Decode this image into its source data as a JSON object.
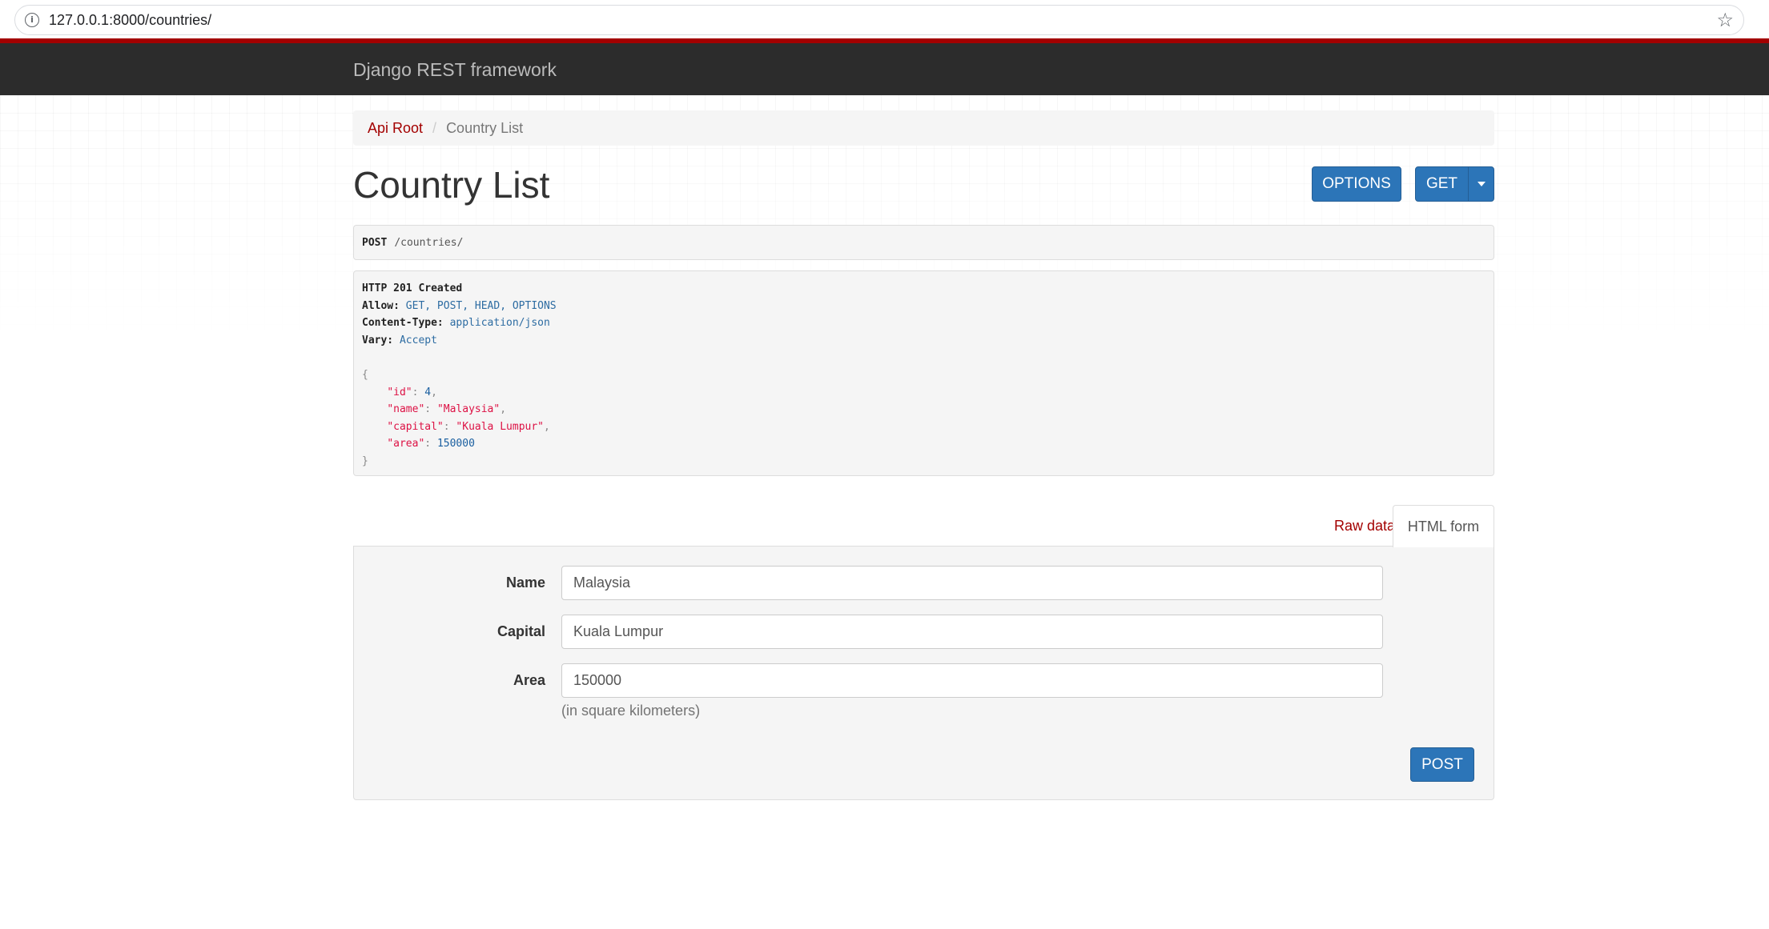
{
  "browser": {
    "url": "127.0.0.1:8000/countries/"
  },
  "navbar": {
    "brand": "Django REST framework"
  },
  "breadcrumb": {
    "items": [
      {
        "label": "Api Root"
      },
      {
        "label": "Country List"
      }
    ],
    "separator": "/"
  },
  "page": {
    "title": "Country List"
  },
  "buttons": {
    "options": "OPTIONS",
    "get": "GET",
    "post": "POST"
  },
  "request": {
    "method": "POST",
    "path": "/countries/"
  },
  "response": {
    "status": "HTTP 201 Created",
    "headers": [
      {
        "name": "Allow:",
        "value": "GET, POST, HEAD, OPTIONS"
      },
      {
        "name": "Content-Type:",
        "value": "application/json"
      },
      {
        "name": "Vary:",
        "value": "Accept"
      }
    ],
    "body": {
      "open": "{",
      "close": "}",
      "fields": [
        {
          "key": "\"id\"",
          "value": "4",
          "value_type": "number",
          "comma": ","
        },
        {
          "key": "\"name\"",
          "value": "\"Malaysia\"",
          "value_type": "string",
          "comma": ","
        },
        {
          "key": "\"capital\"",
          "value": "\"Kuala Lumpur\"",
          "value_type": "string",
          "comma": ","
        },
        {
          "key": "\"area\"",
          "value": "150000",
          "value_type": "number",
          "comma": ""
        }
      ]
    }
  },
  "tabs": {
    "raw": "Raw data",
    "html": "HTML form",
    "active": "HTML form"
  },
  "form": {
    "fields": [
      {
        "label": "Name",
        "value": "Malaysia"
      },
      {
        "label": "Capital",
        "value": "Kuala Lumpur"
      },
      {
        "label": "Area",
        "value": "150000"
      }
    ],
    "area_help": "(in square kilometers)"
  },
  "colors": {
    "brand_red": "#a30000",
    "primary_blue": "#2c75b8",
    "navbar_bg": "#2c2c2c"
  }
}
